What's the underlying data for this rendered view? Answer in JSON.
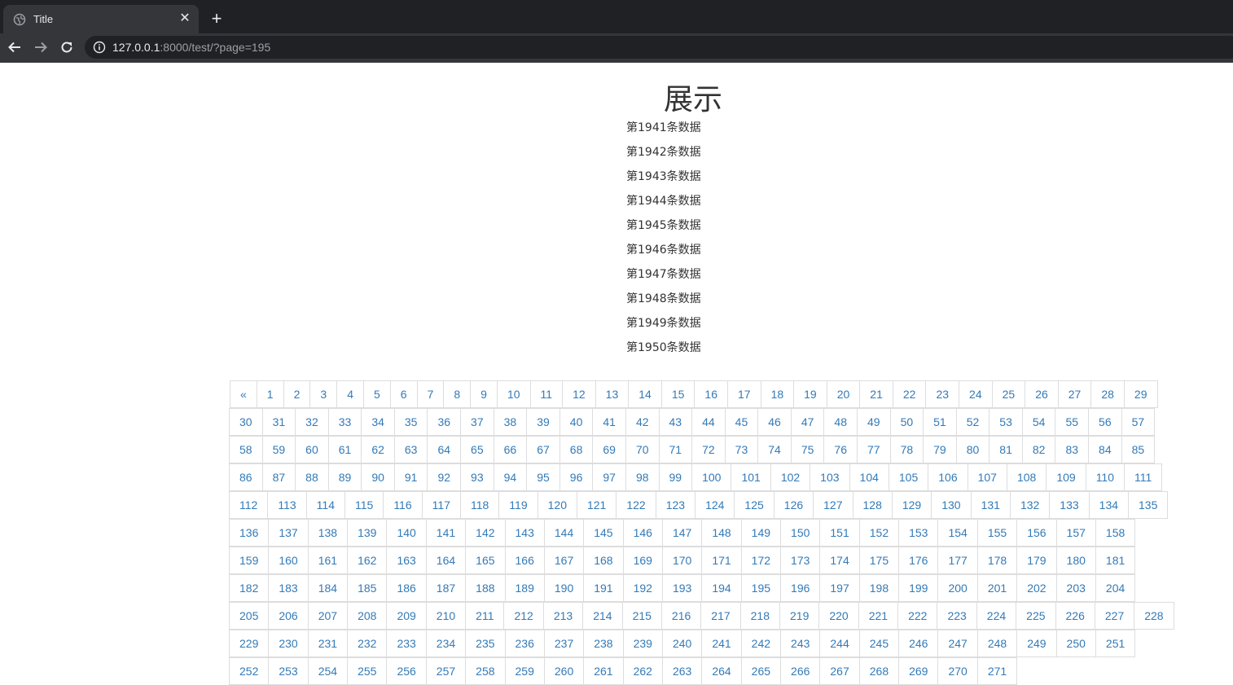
{
  "browser": {
    "tab_title": "Title",
    "url_host": "127.0.0.1",
    "url_rest": ":8000/test/?page=195",
    "tab_close_label": "✕",
    "new_tab_label": "+"
  },
  "page": {
    "title": "展示",
    "items": [
      "第1941条数据",
      "第1942条数据",
      "第1943条数据",
      "第1944条数据",
      "第1945条数据",
      "第1946条数据",
      "第1947条数据",
      "第1948条数据",
      "第1949条数据",
      "第1950条数据"
    ]
  },
  "pagination": {
    "prev_label": "«",
    "first_page": 1,
    "last_visible_page": 271,
    "link_color": "#337ab7",
    "border_color": "#dddddd"
  }
}
